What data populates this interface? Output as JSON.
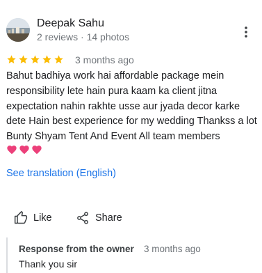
{
  "reviewer": {
    "name": "Deepak Sahu",
    "meta": "2 reviews · 14 photos"
  },
  "review": {
    "rating": 5,
    "max_rating": 5,
    "date": "3 months ago",
    "text": "Bahut badhiya work hai affordable package mein responsibility lete hain pura kaam ka client jitna expectation nahin rakhte usse aur jyada decor karke dete Hain best experience for my wedding Thankss a lot Bunty Shyam Tent And Event All team members",
    "hearts": [
      "❤️",
      "❤️",
      "❤️"
    ]
  },
  "translation_link": "See translation (English)",
  "actions": {
    "like_label": "Like",
    "share_label": "Share"
  },
  "owner_response": {
    "label": "Response from the owner",
    "date": "3 months ago",
    "text": "Thank you sir"
  },
  "colors": {
    "star": "#fbbc04",
    "link": "#1a73e8",
    "heart": "#ec407a",
    "secondary_text": "#70757a"
  },
  "icons": {
    "menu": "more-vert-icon",
    "like": "thumb-up-icon",
    "share": "share-icon",
    "star": "star-icon",
    "heart": "heart-icon"
  }
}
